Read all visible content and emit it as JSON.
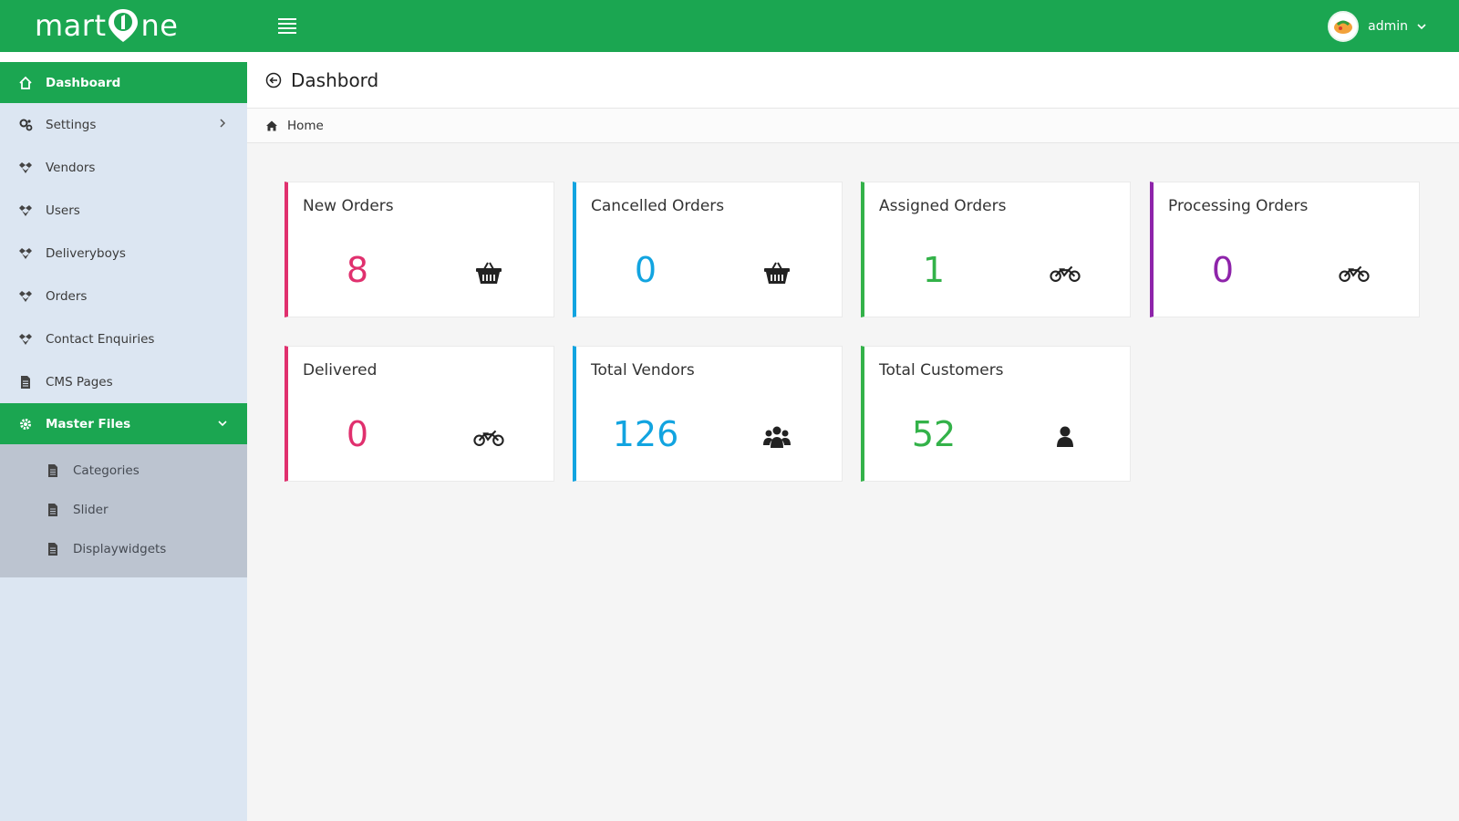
{
  "app": {
    "logo_text_left": "mart",
    "logo_text_right": "ne"
  },
  "header": {
    "user_name": "admin",
    "page_title": "Dashbord",
    "breadcrumb_home": "Home"
  },
  "sidebar": {
    "items": [
      {
        "label": "Dashboard",
        "icon": "home-icon",
        "active": true
      },
      {
        "label": "Settings",
        "icon": "gears-icon"
      },
      {
        "label": "Vendors",
        "icon": "dropbox-icon"
      },
      {
        "label": "Users",
        "icon": "dropbox-icon"
      },
      {
        "label": "Deliveryboys",
        "icon": "dropbox-icon"
      },
      {
        "label": "Orders",
        "icon": "dropbox-icon"
      },
      {
        "label": "Contact Enquiries",
        "icon": "dropbox-icon"
      },
      {
        "label": "CMS Pages",
        "icon": "file-icon"
      },
      {
        "label": "Master Files",
        "icon": "gear-icon",
        "expanded": true
      }
    ],
    "submenu": [
      {
        "label": "Categories",
        "icon": "file-icon"
      },
      {
        "label": "Slider",
        "icon": "file-icon"
      },
      {
        "label": "Displaywidgets",
        "icon": "file-icon"
      }
    ]
  },
  "cards": [
    {
      "title": "New Orders",
      "value": "8",
      "color": "#e0306e",
      "icon": "basket-icon"
    },
    {
      "title": "Cancelled Orders",
      "value": "0",
      "color": "#12a4e0",
      "icon": "basket-icon"
    },
    {
      "title": "Assigned Orders",
      "value": "1",
      "color": "#33b249",
      "icon": "motorcycle-icon"
    },
    {
      "title": "Processing Orders",
      "value": "0",
      "color": "#8e24aa",
      "icon": "motorcycle-icon"
    },
    {
      "title": "Delivered",
      "value": "0",
      "color": "#e0306e",
      "icon": "motorcycle-icon"
    },
    {
      "title": "Total Vendors",
      "value": "126",
      "color": "#12a4e0",
      "icon": "users-icon"
    },
    {
      "title": "Total Customers",
      "value": "52",
      "color": "#33b249",
      "icon": "user-icon"
    }
  ],
  "colors": {
    "brand_green": "#1ba651",
    "sidebar_bg": "#dce6f2",
    "submenu_bg": "#bcc4d0"
  }
}
